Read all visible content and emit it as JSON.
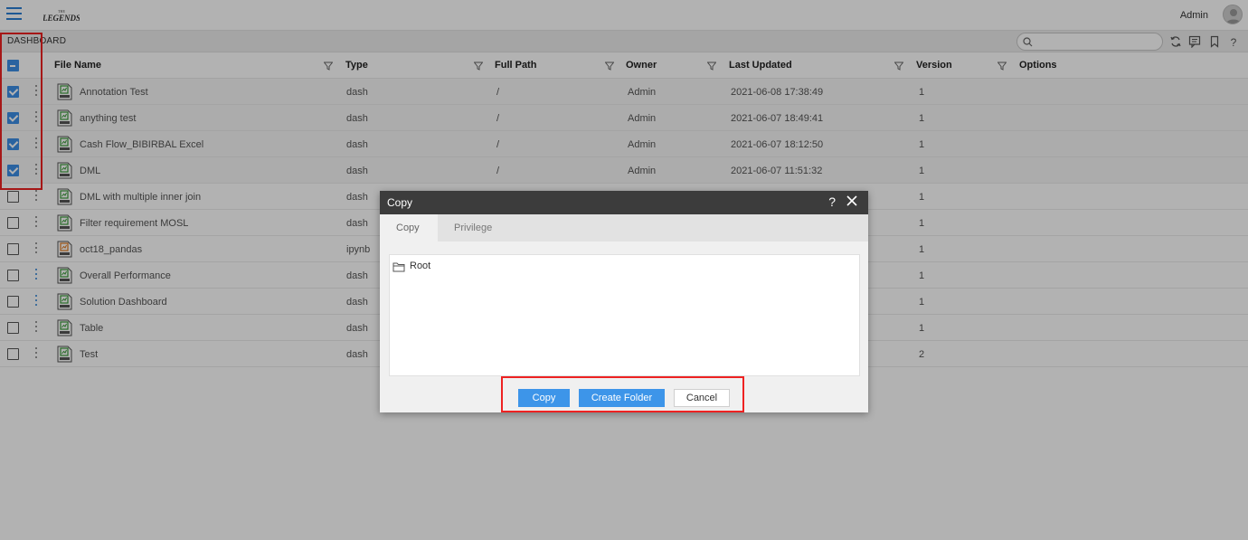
{
  "header": {
    "logo_text": "THE LEGENDS",
    "user_name": "Admin"
  },
  "breadcrumb": "DASHBOARD",
  "search": {
    "placeholder": "",
    "value": ""
  },
  "toolbar_icons": [
    "refresh-icon",
    "comment-icon",
    "bookmark-icon",
    "help-icon"
  ],
  "table": {
    "columns": [
      {
        "label": "File Name"
      },
      {
        "label": "Type"
      },
      {
        "label": "Full Path"
      },
      {
        "label": "Owner"
      },
      {
        "label": "Last Updated"
      },
      {
        "label": "Version"
      },
      {
        "label": "Options"
      }
    ],
    "rows": [
      {
        "checked": true,
        "name": "Annotation Test",
        "type": "dash",
        "path": "/",
        "owner": "Admin",
        "updated": "2021-06-08 17:38:49",
        "version": "1",
        "icon": "dash"
      },
      {
        "checked": true,
        "name": "anything test",
        "type": "dash",
        "path": "/",
        "owner": "Admin",
        "updated": "2021-06-07 18:49:41",
        "version": "1",
        "icon": "dash"
      },
      {
        "checked": true,
        "name": "Cash Flow_BIBIRBAL Excel",
        "type": "dash",
        "path": "/",
        "owner": "Admin",
        "updated": "2021-06-07 18:12:50",
        "version": "1",
        "icon": "dash"
      },
      {
        "checked": true,
        "name": "DML",
        "type": "dash",
        "path": "/",
        "owner": "Admin",
        "updated": "2021-06-07 11:51:32",
        "version": "1",
        "icon": "dash"
      },
      {
        "checked": false,
        "name": "DML with multiple inner join",
        "type": "dash",
        "path": "",
        "owner": "",
        "updated": "",
        "version": "1",
        "icon": "dash"
      },
      {
        "checked": false,
        "name": "Filter requirement MOSL",
        "type": "dash",
        "path": "",
        "owner": "",
        "updated": "",
        "version": "1",
        "icon": "dash"
      },
      {
        "checked": false,
        "name": "oct18_pandas",
        "type": "ipynb",
        "path": "",
        "owner": "",
        "updated": "",
        "version": "1",
        "icon": "ipynb"
      },
      {
        "checked": false,
        "name": "Overall Performance",
        "type": "dash",
        "path": "",
        "owner": "",
        "updated": "",
        "version": "1",
        "icon": "dash"
      },
      {
        "checked": false,
        "name": "Solution Dashboard",
        "type": "dash",
        "path": "",
        "owner": "",
        "updated": "",
        "version": "1",
        "icon": "dash"
      },
      {
        "checked": false,
        "name": "Table",
        "type": "dash",
        "path": "",
        "owner": "",
        "updated": "",
        "version": "1",
        "icon": "dash"
      },
      {
        "checked": false,
        "name": "Test",
        "type": "dash",
        "path": "",
        "owner": "",
        "updated": "",
        "version": "2",
        "icon": "dash"
      }
    ]
  },
  "dialog": {
    "title": "Copy",
    "help": "?",
    "tabs": [
      {
        "label": "Copy",
        "active": true
      },
      {
        "label": "Privilege",
        "active": false
      }
    ],
    "tree_root": "Root",
    "buttons": {
      "copy": "Copy",
      "create_folder": "Create Folder",
      "cancel": "Cancel"
    }
  },
  "colors": {
    "accent": "#3d95e9",
    "highlight_box": "#e22222",
    "dialog_header": "#3c3c3c"
  }
}
